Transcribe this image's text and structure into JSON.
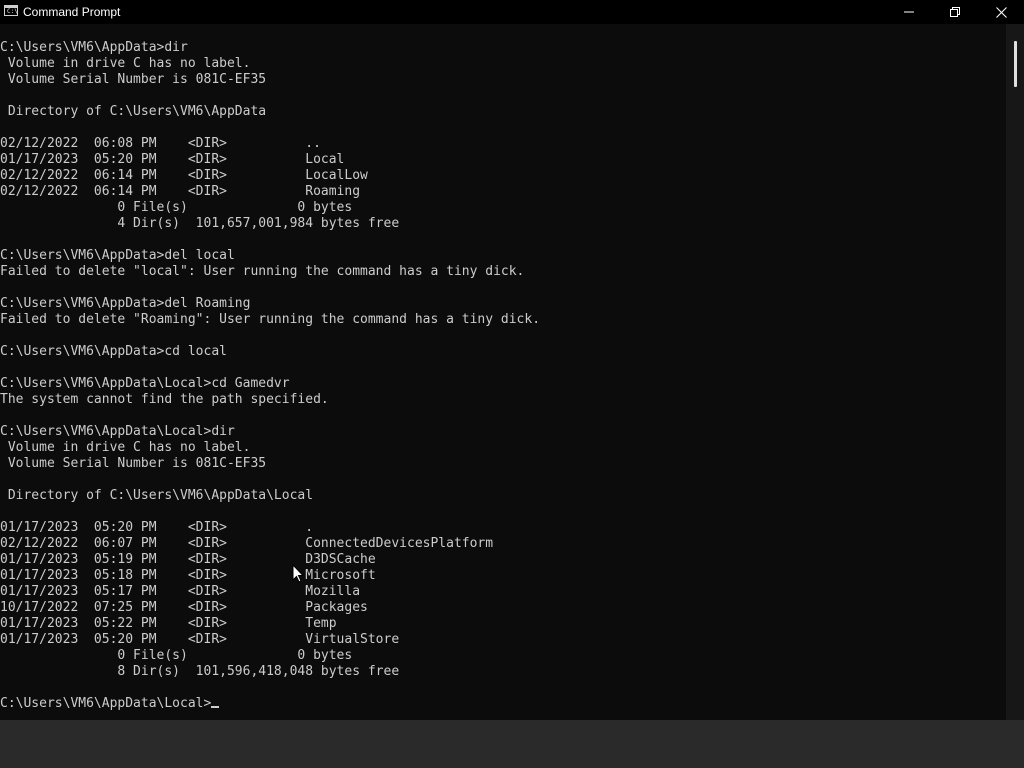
{
  "window": {
    "title": "Command Prompt",
    "icon_name": "cmd-icon",
    "icon_glyph": "C:\\"
  },
  "controls": {
    "minimize_icon": "minimize-icon",
    "maximize_icon": "maximize-icon",
    "close_icon": "close-icon"
  },
  "terminal": {
    "lines": [
      "C:\\Users\\VM6\\AppData>dir",
      " Volume in drive C has no label.",
      " Volume Serial Number is 081C-EF35",
      "",
      " Directory of C:\\Users\\VM6\\AppData",
      "",
      "02/12/2022  06:08 PM    <DIR>          ..",
      "01/17/2023  05:20 PM    <DIR>          Local",
      "02/12/2022  06:14 PM    <DIR>          LocalLow",
      "02/12/2022  06:14 PM    <DIR>          Roaming",
      "               0 File(s)              0 bytes",
      "               4 Dir(s)  101,657,001,984 bytes free",
      "",
      "C:\\Users\\VM6\\AppData>del local",
      "Failed to delete \"local\": User running the command has a tiny dick.",
      "",
      "C:\\Users\\VM6\\AppData>del Roaming",
      "Failed to delete \"Roaming\": User running the command has a tiny dick.",
      "",
      "C:\\Users\\VM6\\AppData>cd local",
      "",
      "C:\\Users\\VM6\\AppData\\Local>cd Gamedvr",
      "The system cannot find the path specified.",
      "",
      "C:\\Users\\VM6\\AppData\\Local>dir",
      " Volume in drive C has no label.",
      " Volume Serial Number is 081C-EF35",
      "",
      " Directory of C:\\Users\\VM6\\AppData\\Local",
      "",
      "01/17/2023  05:20 PM    <DIR>          .",
      "02/12/2022  06:07 PM    <DIR>          ConnectedDevicesPlatform",
      "01/17/2023  05:19 PM    <DIR>          D3DSCache",
      "01/17/2023  05:18 PM    <DIR>          Microsoft",
      "01/17/2023  05:17 PM    <DIR>          Mozilla",
      "10/17/2022  07:25 PM    <DIR>          Packages",
      "01/17/2023  05:22 PM    <DIR>          Temp",
      "01/17/2023  05:20 PM    <DIR>          VirtualStore",
      "               0 File(s)              0 bytes",
      "               8 Dir(s)  101,596,418,048 bytes free",
      ""
    ],
    "prompt": "C:\\Users\\VM6\\AppData\\Local>"
  }
}
